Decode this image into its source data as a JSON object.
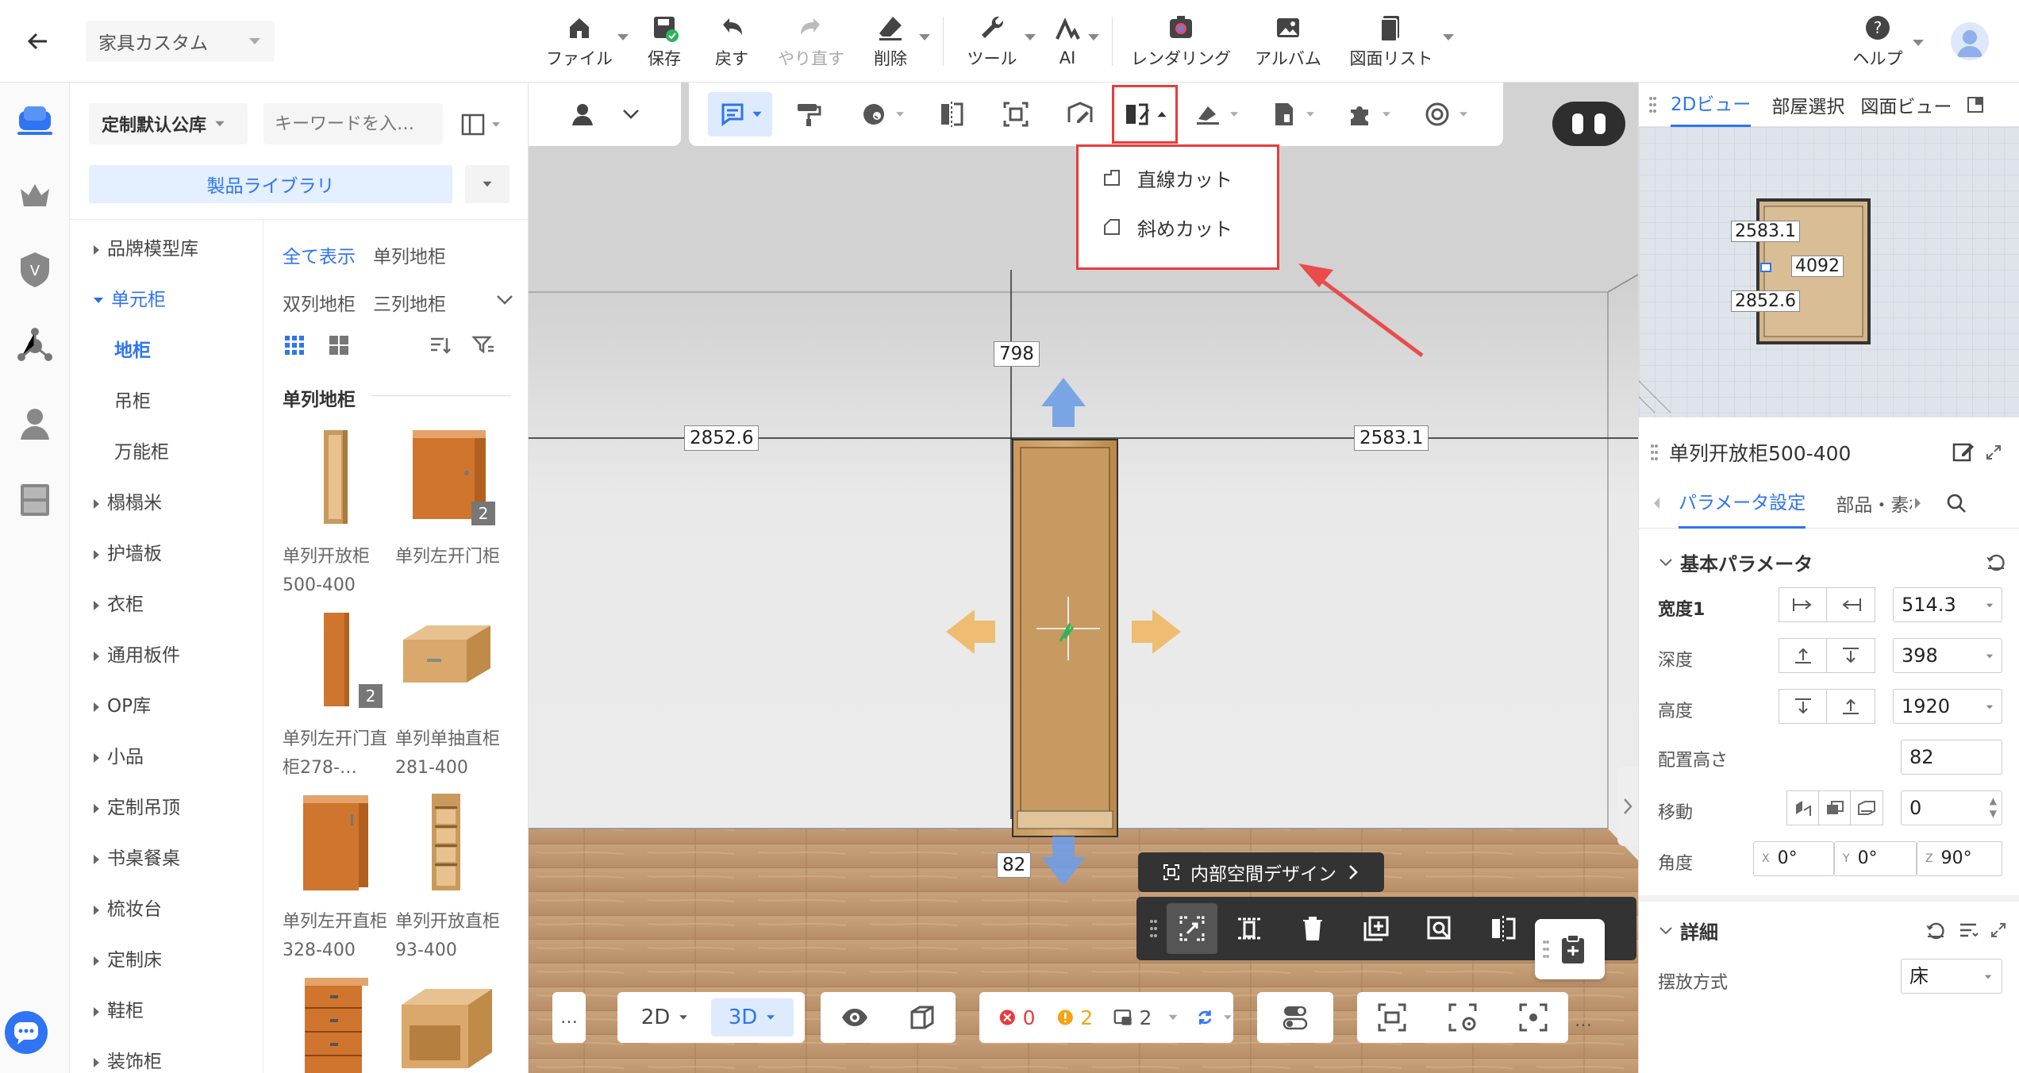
{
  "header": {
    "back": "back-arrow",
    "project_name": "家具カスタム",
    "tools": [
      {
        "label": "ファイル",
        "icon": "home-icon"
      },
      {
        "label": "保存",
        "icon": "save-icon"
      },
      {
        "label": "戻す",
        "icon": "undo-icon"
      },
      {
        "label": "やり直す",
        "icon": "redo-icon"
      },
      {
        "label": "削除",
        "icon": "eraser-icon"
      },
      {
        "label": "ツール",
        "icon": "wrench-icon"
      },
      {
        "label": "AI",
        "icon": "ai-icon"
      },
      {
        "label": "レンダリング",
        "icon": "render-icon"
      },
      {
        "label": "アルバム",
        "icon": "album-icon"
      },
      {
        "label": "図面リスト",
        "icon": "drawing-list-icon"
      },
      {
        "label": "ヘルプ",
        "icon": "help-icon"
      }
    ]
  },
  "library": {
    "source_select": "定制默认公库",
    "search_placeholder": "キーワードを入…",
    "product_library_btn": "製品ライブラリ",
    "categories": [
      "品牌模型库",
      "单元柜",
      "地柜",
      "吊柜",
      "万能柜",
      "榻榻米",
      "护墙板",
      "衣柜",
      "通用板件",
      "OP库",
      "小品",
      "定制吊顶",
      "书桌餐桌",
      "梳妆台",
      "定制床",
      "鞋柜",
      "装饰柜"
    ],
    "filters": {
      "all": "全て表示",
      "f1": "单列地柜",
      "f2": "双列地柜",
      "f3": "三列地柜"
    },
    "section_title": "单列地柜",
    "products": [
      {
        "name": "单列开放柜500-400",
        "badge": ""
      },
      {
        "name": "单列左开门柜",
        "badge": "2"
      },
      {
        "name": "单列左开门直柜278-…",
        "badge": "2"
      },
      {
        "name": "单列单抽直柜281-400",
        "badge": ""
      },
      {
        "name": "单列左开直柜328-400",
        "badge": ""
      },
      {
        "name": "单列开放直柜93-400",
        "badge": ""
      }
    ]
  },
  "viewport": {
    "dims": {
      "top": "798",
      "left": "2852.6",
      "right": "2583.1",
      "bottom": "82"
    },
    "cut_menu": [
      "直線カット",
      "斜めカット"
    ],
    "interior_design_btn": "内部空間デザイン",
    "bottom": {
      "v2d": "2D",
      "v3d": "3D",
      "errors": "0",
      "warnings": "2",
      "layers": "2",
      "more": "…"
    }
  },
  "minimap": {
    "tabs": [
      "2Dビュー",
      "部屋選択",
      "図面ビュー"
    ],
    "labels": [
      "2583.1",
      "4092",
      "2852.6"
    ]
  },
  "properties": {
    "title": "单列开放柜500-400",
    "tabs": [
      "パラメータ設定",
      "部品・素材"
    ],
    "section_basic": "基本パラメータ",
    "params": [
      {
        "label": "宽度1",
        "value": "514.3"
      },
      {
        "label": "深度",
        "value": "398"
      },
      {
        "label": "高度",
        "value": "1920"
      },
      {
        "label": "配置高さ",
        "value": "82"
      },
      {
        "label": "移動",
        "value": "0"
      }
    ],
    "angle": {
      "label": "角度",
      "x": "0°",
      "y": "0°",
      "z": "90°",
      "xl": "X",
      "yl": "Y",
      "zl": "Z"
    },
    "section_detail": "詳細",
    "placement": {
      "label": "摆放方式",
      "value": "床"
    }
  }
}
